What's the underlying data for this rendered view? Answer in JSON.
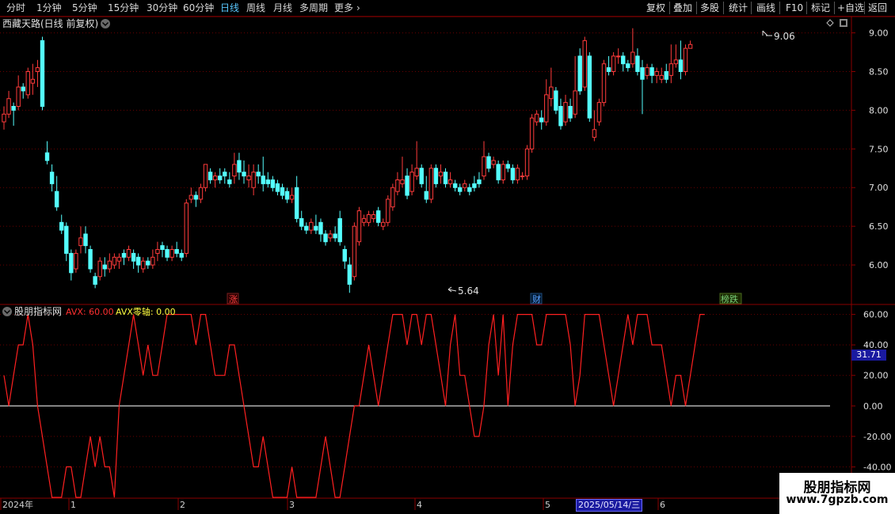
{
  "toolbar": {
    "periods": [
      "分时",
      "1分钟",
      "5分钟",
      "15分钟",
      "30分钟",
      "60分钟",
      "日线",
      "周线",
      "月线",
      "多周期",
      "更多"
    ],
    "active_period": "日线",
    "actions": [
      "复权",
      "叠加",
      "多股",
      "统计",
      "画线",
      "F10",
      "标记",
      "+自选",
      "返回"
    ]
  },
  "main_panel": {
    "title": "西藏天路(日线 前复权)",
    "high_label": "9.06",
    "low_label": "5.64",
    "markers": [
      {
        "text": "涨",
        "color": "#ff4040"
      },
      {
        "text": "财",
        "color": "#5aa0ff"
      },
      {
        "text": "榜跌",
        "color": "#7ad07a"
      }
    ]
  },
  "indicator_panel": {
    "name": "股朋指标网",
    "avx_label": "AVX: 60.00",
    "zero_label": "AVX零轴: 0.00",
    "current_value": "31.71"
  },
  "x_axis": {
    "labels": [
      "2024年",
      "1",
      "2",
      "3",
      "4",
      "5",
      "6"
    ],
    "cursor_date": "2025/05/14/三"
  },
  "watermark": {
    "line1": "股朋指标网",
    "line2": "www.7gpzb.com"
  },
  "colors": {
    "up": "#ff3b3b",
    "down": "#54ffff",
    "axis": "#8a0000",
    "grid": "#6a0000",
    "line": "#ff2020",
    "zero": "#ffffff"
  },
  "chart_data": [
    {
      "type": "candlestick",
      "title": "西藏天路(日线 前复权)",
      "y_ticks": [
        "9.00",
        "8.50",
        "8.00",
        "7.50",
        "7.00",
        "6.50",
        "6.00"
      ],
      "ylim": [
        5.5,
        9.2
      ],
      "x_labels": [
        "2024年",
        "1",
        "2",
        "3",
        "4",
        "5",
        "6"
      ],
      "annotations": [
        {
          "text": "9.06",
          "value": 9.06
        },
        {
          "text": "5.64",
          "value": 5.64
        }
      ],
      "candles": [
        [
          7.85,
          7.95,
          7.75,
          8.05
        ],
        [
          7.95,
          8.15,
          7.9,
          8.25
        ],
        [
          8.05,
          8.0,
          7.8,
          8.1
        ],
        [
          8.05,
          8.3,
          8.0,
          8.45
        ],
        [
          8.3,
          8.25,
          8.15,
          8.35
        ],
        [
          8.2,
          8.5,
          8.15,
          8.55
        ],
        [
          8.35,
          8.4,
          8.2,
          8.6
        ],
        [
          8.5,
          8.55,
          8.3,
          8.65
        ],
        [
          8.9,
          8.05,
          8.0,
          8.95
        ],
        [
          7.45,
          7.35,
          7.3,
          7.6
        ],
        [
          7.2,
          7.05,
          6.95,
          7.3
        ],
        [
          6.95,
          6.75,
          6.7,
          7.15
        ],
        [
          6.55,
          6.45,
          6.4,
          6.65
        ],
        [
          6.5,
          6.15,
          6.05,
          6.55
        ],
        [
          6.15,
          5.9,
          5.8,
          6.2
        ],
        [
          5.95,
          6.15,
          5.9,
          6.2
        ],
        [
          6.25,
          6.35,
          6.15,
          6.5
        ],
        [
          6.4,
          6.25,
          6.15,
          6.5
        ],
        [
          6.2,
          5.95,
          5.9,
          6.25
        ],
        [
          5.85,
          5.75,
          5.7,
          5.9
        ],
        [
          5.85,
          6.05,
          5.8,
          6.1
        ],
        [
          6.0,
          5.95,
          5.85,
          6.1
        ],
        [
          5.95,
          6.05,
          5.9,
          6.15
        ],
        [
          6.0,
          6.1,
          5.95,
          6.15
        ],
        [
          6.05,
          6.1,
          5.95,
          6.15
        ],
        [
          6.15,
          6.1,
          6.0,
          6.2
        ],
        [
          6.1,
          6.2,
          6.05,
          6.25
        ],
        [
          6.15,
          6.05,
          5.95,
          6.2
        ],
        [
          6.1,
          6.0,
          5.9,
          6.15
        ],
        [
          5.95,
          6.05,
          5.9,
          6.1
        ],
        [
          6.05,
          6.0,
          5.95,
          6.1
        ],
        [
          6.0,
          6.1,
          5.95,
          6.2
        ],
        [
          6.15,
          6.2,
          6.05,
          6.3
        ],
        [
          6.25,
          6.2,
          6.1,
          6.3
        ],
        [
          6.2,
          6.1,
          6.05,
          6.25
        ],
        [
          6.1,
          6.2,
          6.05,
          6.25
        ],
        [
          6.2,
          6.15,
          6.1,
          6.3
        ],
        [
          6.15,
          6.1,
          6.05,
          6.2
        ],
        [
          6.15,
          6.8,
          6.1,
          6.85
        ],
        [
          6.85,
          6.9,
          6.8,
          7.0
        ],
        [
          6.9,
          6.85,
          6.75,
          6.95
        ],
        [
          6.85,
          7.0,
          6.8,
          7.05
        ],
        [
          7.0,
          7.3,
          6.95,
          7.3
        ],
        [
          7.2,
          7.1,
          7.05,
          7.25
        ],
        [
          7.1,
          7.15,
          7.0,
          7.2
        ],
        [
          7.15,
          7.1,
          7.05,
          7.25
        ],
        [
          7.2,
          7.15,
          7.05,
          7.25
        ],
        [
          7.1,
          7.05,
          7.0,
          7.2
        ],
        [
          7.15,
          7.3,
          7.05,
          7.45
        ],
        [
          7.35,
          7.2,
          7.1,
          7.45
        ],
        [
          7.2,
          7.15,
          7.05,
          7.35
        ],
        [
          7.1,
          7.15,
          7.0,
          7.3
        ],
        [
          7.0,
          7.2,
          6.9,
          7.3
        ],
        [
          7.2,
          7.15,
          7.05,
          7.3
        ],
        [
          7.15,
          7.05,
          6.95,
          7.4
        ],
        [
          7.1,
          7.05,
          7.0,
          7.2
        ],
        [
          7.1,
          7.0,
          6.95,
          7.15
        ],
        [
          7.05,
          6.95,
          6.9,
          7.1
        ],
        [
          7.0,
          6.9,
          6.85,
          7.05
        ],
        [
          6.95,
          6.85,
          6.8,
          7.0
        ],
        [
          6.85,
          6.9,
          6.8,
          7.0
        ],
        [
          7.0,
          6.6,
          6.55,
          7.15
        ],
        [
          6.6,
          6.5,
          6.45,
          6.7
        ],
        [
          6.5,
          6.45,
          6.4,
          6.55
        ],
        [
          6.45,
          6.55,
          6.4,
          6.6
        ],
        [
          6.5,
          6.45,
          6.4,
          6.65
        ],
        [
          6.55,
          6.4,
          6.3,
          6.6
        ],
        [
          6.4,
          6.3,
          6.25,
          6.45
        ],
        [
          6.35,
          6.4,
          6.3,
          6.45
        ],
        [
          6.4,
          6.35,
          6.3,
          6.5
        ],
        [
          6.6,
          6.3,
          6.25,
          6.7
        ],
        [
          6.2,
          6.05,
          5.95,
          6.25
        ],
        [
          6.0,
          5.75,
          5.64,
          6.1
        ],
        [
          5.85,
          6.5,
          5.8,
          6.55
        ],
        [
          6.3,
          6.7,
          6.25,
          6.75
        ],
        [
          6.55,
          6.6,
          6.5,
          6.65
        ],
        [
          6.55,
          6.65,
          6.5,
          6.7
        ],
        [
          6.6,
          6.65,
          6.55,
          6.7
        ],
        [
          6.7,
          6.55,
          6.5,
          6.75
        ],
        [
          6.5,
          6.55,
          6.45,
          6.6
        ],
        [
          6.55,
          6.85,
          6.5,
          6.9
        ],
        [
          6.75,
          7.0,
          6.7,
          7.05
        ],
        [
          6.95,
          7.1,
          6.9,
          7.2
        ],
        [
          7.05,
          7.1,
          7.0,
          7.4
        ],
        [
          7.15,
          6.9,
          6.85,
          7.25
        ],
        [
          6.95,
          7.2,
          6.9,
          7.3
        ],
        [
          7.15,
          7.25,
          7.1,
          7.6
        ],
        [
          7.25,
          7.05,
          7.0,
          7.3
        ],
        [
          6.95,
          6.85,
          6.8,
          7.15
        ],
        [
          6.85,
          7.25,
          6.8,
          7.3
        ],
        [
          7.25,
          7.05,
          7.0,
          7.3
        ],
        [
          7.15,
          7.2,
          7.05,
          7.3
        ],
        [
          7.2,
          7.05,
          7.0,
          7.25
        ],
        [
          7.05,
          7.1,
          7.0,
          7.2
        ],
        [
          7.05,
          7.0,
          6.95,
          7.1
        ],
        [
          7.0,
          6.95,
          6.9,
          7.05
        ],
        [
          7.0,
          7.05,
          6.95,
          7.1
        ],
        [
          7.0,
          6.95,
          6.9,
          7.05
        ],
        [
          7.05,
          7.0,
          6.95,
          7.15
        ],
        [
          7.1,
          7.05,
          7.0,
          7.2
        ],
        [
          7.15,
          7.4,
          7.1,
          7.6
        ],
        [
          7.4,
          7.25,
          7.2,
          7.45
        ],
        [
          7.3,
          7.35,
          7.25,
          7.4
        ],
        [
          7.3,
          7.1,
          7.05,
          7.35
        ],
        [
          7.1,
          7.3,
          7.05,
          7.35
        ],
        [
          7.3,
          7.25,
          7.2,
          7.35
        ],
        [
          7.25,
          7.1,
          7.05,
          7.3
        ],
        [
          7.1,
          7.25,
          7.05,
          7.3
        ],
        [
          7.15,
          7.15,
          7.1,
          7.2
        ],
        [
          7.15,
          7.5,
          7.1,
          7.55
        ],
        [
          7.5,
          7.9,
          7.45,
          7.95
        ],
        [
          7.85,
          7.95,
          7.8,
          8.0
        ],
        [
          7.9,
          7.85,
          7.75,
          8.0
        ],
        [
          7.85,
          8.2,
          7.8,
          8.4
        ],
        [
          8.15,
          8.3,
          8.05,
          8.55
        ],
        [
          8.25,
          8.0,
          7.95,
          8.3
        ],
        [
          8.05,
          7.8,
          7.75,
          8.15
        ],
        [
          7.85,
          8.1,
          7.8,
          8.2
        ],
        [
          8.05,
          7.9,
          7.85,
          8.15
        ],
        [
          7.95,
          8.25,
          7.9,
          8.7
        ],
        [
          8.7,
          8.25,
          8.2,
          8.8
        ],
        [
          8.3,
          8.9,
          8.25,
          8.95
        ],
        [
          8.7,
          7.9,
          7.85,
          8.75
        ],
        [
          7.65,
          7.75,
          7.6,
          8.0
        ],
        [
          7.85,
          8.1,
          7.8,
          8.15
        ],
        [
          8.1,
          8.6,
          8.05,
          8.65
        ],
        [
          8.55,
          8.5,
          8.45,
          8.7
        ],
        [
          8.5,
          8.7,
          8.45,
          8.75
        ],
        [
          8.7,
          8.7,
          8.6,
          8.8
        ],
        [
          8.7,
          8.6,
          8.5,
          8.75
        ],
        [
          8.6,
          8.55,
          8.5,
          8.65
        ],
        [
          8.6,
          8.75,
          8.55,
          9.06
        ],
        [
          8.7,
          8.5,
          8.45,
          8.8
        ],
        [
          8.55,
          8.4,
          7.95,
          8.65
        ],
        [
          8.45,
          8.55,
          8.4,
          8.6
        ],
        [
          8.55,
          8.45,
          8.35,
          8.6
        ],
        [
          8.45,
          8.5,
          8.35,
          8.55
        ],
        [
          8.4,
          8.45,
          8.35,
          8.55
        ],
        [
          8.5,
          8.4,
          8.35,
          8.6
        ],
        [
          8.45,
          8.6,
          8.35,
          8.85
        ],
        [
          8.6,
          8.65,
          8.55,
          8.85
        ],
        [
          8.65,
          8.5,
          8.4,
          8.9
        ],
        [
          8.5,
          8.8,
          8.45,
          8.85
        ],
        [
          8.8,
          8.85,
          8.8,
          8.9
        ]
      ]
    },
    {
      "type": "line",
      "name": "AVX",
      "y_ticks": [
        "60.00",
        "40.00",
        "20.00",
        "0.00",
        "-20.00",
        "-40.00"
      ],
      "ylim": [
        -60,
        66
      ],
      "values": [
        20,
        0,
        20,
        40,
        40,
        60,
        40,
        0,
        -20,
        -40,
        -60,
        -60,
        -60,
        -40,
        -40,
        -60,
        -60,
        -40,
        -20,
        -40,
        -20,
        -40,
        -40,
        -60,
        0,
        20,
        40,
        60,
        40,
        20,
        40,
        20,
        20,
        40,
        60,
        60,
        60,
        60,
        60,
        60,
        40,
        60,
        60,
        40,
        20,
        20,
        20,
        40,
        40,
        20,
        0,
        -20,
        -40,
        -40,
        -20,
        -40,
        -60,
        -60,
        -60,
        -60,
        -40,
        -60,
        -60,
        -60,
        -60,
        -60,
        -40,
        -20,
        -40,
        -60,
        -60,
        -40,
        -20,
        0,
        0,
        20,
        40,
        20,
        0,
        20,
        40,
        60,
        60,
        60,
        40,
        60,
        60,
        40,
        60,
        60,
        40,
        20,
        0,
        40,
        60,
        20,
        20,
        0,
        -20,
        -20,
        0,
        40,
        60,
        20,
        60,
        0,
        40,
        60,
        60,
        60,
        60,
        40,
        40,
        60,
        60,
        60,
        60,
        60,
        40,
        0,
        20,
        60,
        60,
        60,
        60,
        40,
        20,
        0,
        20,
        40,
        60,
        40,
        60,
        60,
        60,
        40,
        40,
        40,
        20,
        0,
        20,
        20,
        0,
        20,
        40,
        60,
        60
      ]
    }
  ]
}
